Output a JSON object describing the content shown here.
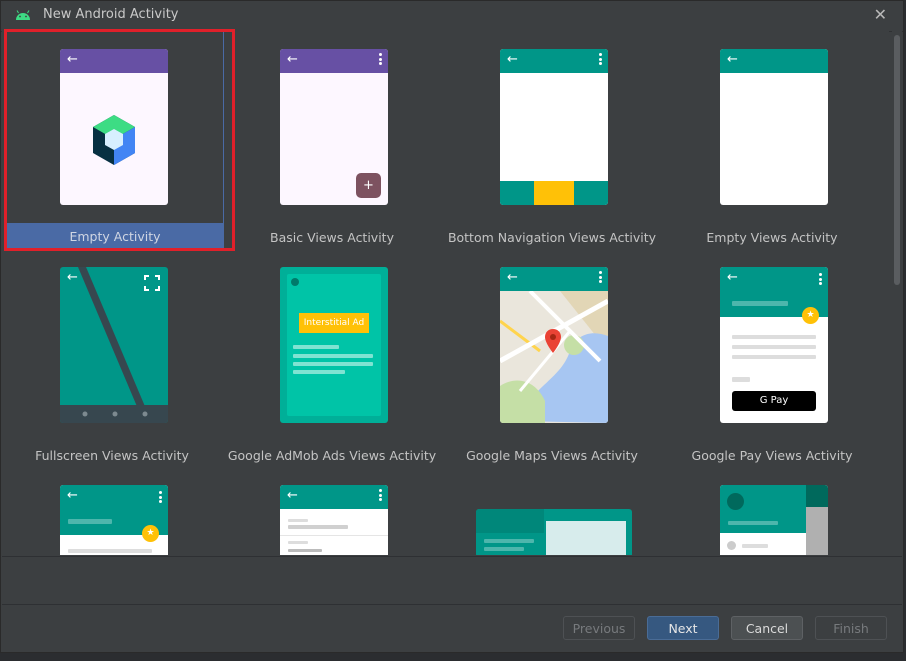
{
  "window": {
    "title": "New Android Activity",
    "close_label": "✕"
  },
  "templates": [
    {
      "label": "Empty Activity"
    },
    {
      "label": "Basic Views Activity"
    },
    {
      "label": "Bottom Navigation Views Activity"
    },
    {
      "label": "Empty Views Activity"
    },
    {
      "label": "Fullscreen Views Activity"
    },
    {
      "label": "Google AdMob Ads Views Activity",
      "badge": "Interstitial Ad"
    },
    {
      "label": "Google Maps Views Activity"
    },
    {
      "label": "Google Pay Views Activity",
      "pay_label": "G Pay"
    }
  ],
  "footer": {
    "previous": "Previous",
    "next": "Next",
    "cancel": "Cancel",
    "finish": "Finish"
  },
  "colors": {
    "selection": "#4a6aa5",
    "highlight_box": "#e0202a",
    "teal": "#009688",
    "purple": "#6750a4"
  }
}
